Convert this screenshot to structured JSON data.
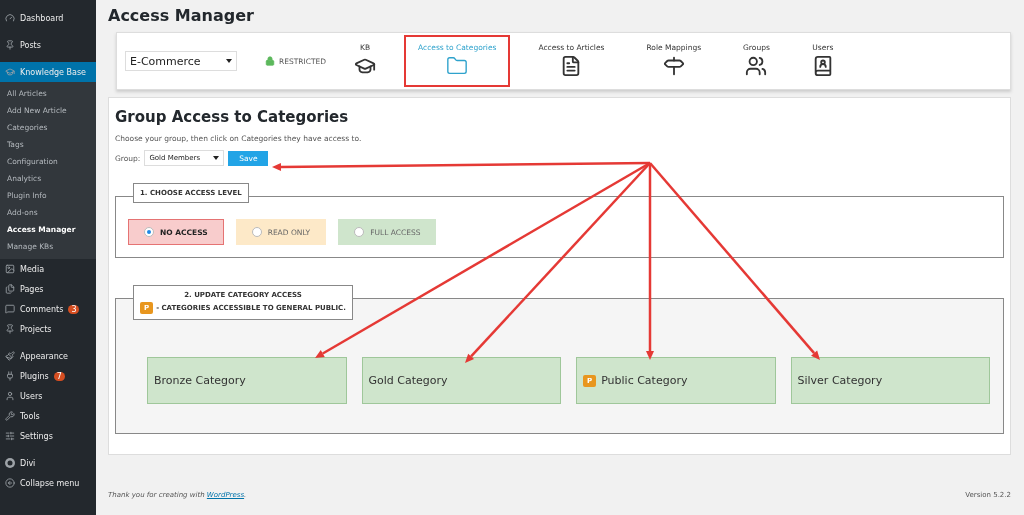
{
  "sidebar": {
    "items": [
      {
        "label": "Dashboard",
        "selected": false
      },
      {
        "label": "Posts",
        "selected": false
      },
      {
        "label": "Knowledge Base",
        "selected": true,
        "children": [
          {
            "label": "All Articles",
            "selected": false
          },
          {
            "label": "Add New Article",
            "selected": false
          },
          {
            "label": "Categories",
            "selected": false
          },
          {
            "label": "Tags",
            "selected": false
          },
          {
            "label": "Configuration",
            "selected": false
          },
          {
            "label": "Analytics",
            "selected": false
          },
          {
            "label": "Plugin Info",
            "selected": false
          },
          {
            "label": "Add-ons",
            "selected": false
          },
          {
            "label": "Access Manager",
            "selected": true
          },
          {
            "label": "Manage KBs",
            "selected": false
          }
        ]
      },
      {
        "label": "Media",
        "selected": false
      },
      {
        "label": "Pages",
        "selected": false
      },
      {
        "label": "Comments",
        "selected": false,
        "badge": "3"
      },
      {
        "label": "Projects",
        "selected": false
      },
      {
        "label": "Appearance",
        "selected": false
      },
      {
        "label": "Plugins",
        "selected": false,
        "badge": "7"
      },
      {
        "label": "Users",
        "selected": false
      },
      {
        "label": "Tools",
        "selected": false
      },
      {
        "label": "Settings",
        "selected": false
      },
      {
        "label": "Divi",
        "selected": false
      },
      {
        "label": "Collapse menu",
        "selected": false
      }
    ]
  },
  "page_title": "Access Manager",
  "toolbar": {
    "kb_select": "E-Commerce",
    "status": "RESTRICTED",
    "tabs": [
      {
        "label": "KB",
        "selected": false
      },
      {
        "label": "Access to Categories",
        "selected": true
      },
      {
        "label": "Access to Articles",
        "selected": false
      },
      {
        "label": "Role Mappings",
        "selected": false
      },
      {
        "label": "Groups",
        "selected": false
      },
      {
        "label": "Users",
        "selected": false
      }
    ]
  },
  "content": {
    "title": "Group Access to Categories",
    "description": "Choose your group, then click on Categories they have access to.",
    "group_label": "Group:",
    "group_value": "Gold Members",
    "save_button": "Save",
    "access_section": {
      "legend": "1. CHOOSE ACCESS LEVEL",
      "options": [
        {
          "label": "NO ACCESS",
          "selected": true,
          "color": "#f8cccc"
        },
        {
          "label": "READ ONLY",
          "selected": false,
          "color": "#fde9c8"
        },
        {
          "label": "FULL ACCESS",
          "selected": false,
          "color": "#cfe5cc"
        }
      ]
    },
    "category_section": {
      "legend": "2. UPDATE CATEGORY ACCESS",
      "public_badge": "P",
      "public_note": "- CATEGORIES ACCESSIBLE TO GENERAL PUBLIC.",
      "categories": [
        {
          "name": "Bronze Category",
          "public": false
        },
        {
          "name": "Gold Category",
          "public": false
        },
        {
          "name": "Public Category",
          "public": true,
          "badge": "P"
        },
        {
          "name": "Silver Category",
          "public": false
        }
      ]
    }
  },
  "footer": {
    "thanks": "Thank you for creating with",
    "link": "WordPress",
    "after_link": ".",
    "version": "Version 5.2.2"
  }
}
